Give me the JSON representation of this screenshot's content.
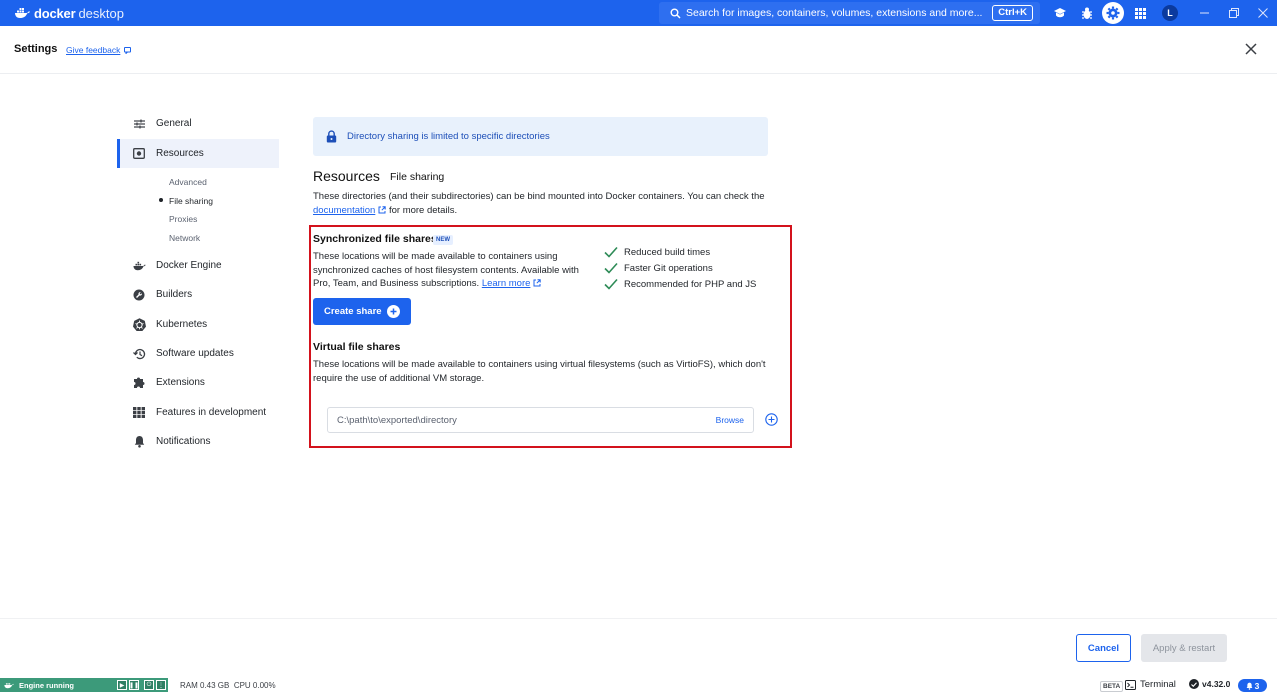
{
  "titlebar": {
    "app_name_bold": "docker",
    "app_name_light": "desktop",
    "search_placeholder": "Search for images, containers, volumes, extensions and more...",
    "search_shortcut": "Ctrl+K",
    "avatar_initial": "L",
    "icons": [
      "learning-center-icon",
      "bug-icon",
      "gear-icon",
      "apps-grid-icon"
    ]
  },
  "header": {
    "title": "Settings",
    "feedback_label": "Give feedback"
  },
  "sidebar": {
    "items": [
      {
        "label": "General",
        "icon": "sliders-icon"
      },
      {
        "label": "Resources",
        "icon": "resources-icon"
      },
      {
        "label": "Docker Engine",
        "icon": "whale-icon"
      },
      {
        "label": "Builders",
        "icon": "wrench-icon"
      },
      {
        "label": "Kubernetes",
        "icon": "kubernetes-icon"
      },
      {
        "label": "Software updates",
        "icon": "history-icon"
      },
      {
        "label": "Extensions",
        "icon": "puzzle-icon"
      },
      {
        "label": "Features in development",
        "icon": "grid-icon"
      },
      {
        "label": "Notifications",
        "icon": "bell-icon"
      }
    ],
    "sub_items": [
      "Advanced",
      "File sharing",
      "Proxies",
      "Network"
    ],
    "active_item": "Resources",
    "active_sub_item": "File sharing"
  },
  "main": {
    "banner": "Directory sharing is limited to specific directories",
    "title": "Resources",
    "subtitle": "File sharing",
    "description_pre": "These directories (and their subdirectories) can be bind mounted into Docker containers. You can check the",
    "description_link": "documentation",
    "description_post": "for more details.",
    "sync": {
      "title": "Synchronized file shares",
      "badge": "NEW",
      "description": "These locations will be made available to containers using synchronized caches of host filesystem contents. Available with Pro, Team, and Business subscriptions.",
      "learn_more": "Learn more",
      "benefits": [
        "Reduced build times",
        "Faster Git operations",
        "Recommended for PHP and JS"
      ],
      "create_button": "Create share"
    },
    "virtual": {
      "title": "Virtual file shares",
      "description": "These locations will be made available to containers using virtual filesystems (such as VirtioFS), which don't require the use of additional VM storage.",
      "path_placeholder": "C:\\path\\to\\exported\\directory",
      "browse_label": "Browse"
    }
  },
  "footer": {
    "cancel_label": "Cancel",
    "apply_label": "Apply & restart"
  },
  "statusbar": {
    "engine_status": "Engine running",
    "ram": "RAM 0.43 GB",
    "cpu": "CPU 0.00%",
    "beta": "BETA",
    "terminal": "Terminal",
    "version": "v4.32.0",
    "notifications_count": "3"
  },
  "colors": {
    "brand": "#1d63ed",
    "highlight_border": "#d3121c",
    "engine_green": "#3c9a7a",
    "check_green": "#2e8b57"
  }
}
